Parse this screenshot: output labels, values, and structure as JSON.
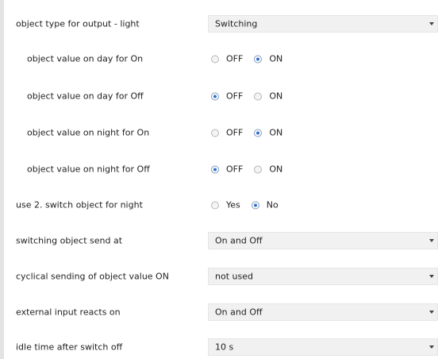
{
  "rows": [
    {
      "label": "object type for output - light",
      "control": "select",
      "value": "Switching"
    },
    {
      "label": "object value on day for On",
      "control": "radio",
      "options": [
        "OFF",
        "ON"
      ],
      "selected": "ON"
    },
    {
      "label": "object value on day for Off",
      "control": "radio",
      "options": [
        "OFF",
        "ON"
      ],
      "selected": "OFF"
    },
    {
      "label": "object value on night for On",
      "control": "radio",
      "options": [
        "OFF",
        "ON"
      ],
      "selected": "ON"
    },
    {
      "label": "object value on night for Off",
      "control": "radio",
      "options": [
        "OFF",
        "ON"
      ],
      "selected": "OFF"
    },
    {
      "label": "use 2. switch object for night",
      "control": "radio",
      "options": [
        "Yes",
        "No"
      ],
      "selected": "No"
    },
    {
      "label": "switching object send at",
      "control": "select",
      "value": "On and Off"
    },
    {
      "label": "cyclical sending of object value ON",
      "control": "select",
      "value": "not used"
    },
    {
      "label": "external input reacts on",
      "control": "select",
      "value": "On and Off"
    },
    {
      "label": "idle time after switch off",
      "control": "select",
      "value": "10 s"
    }
  ]
}
